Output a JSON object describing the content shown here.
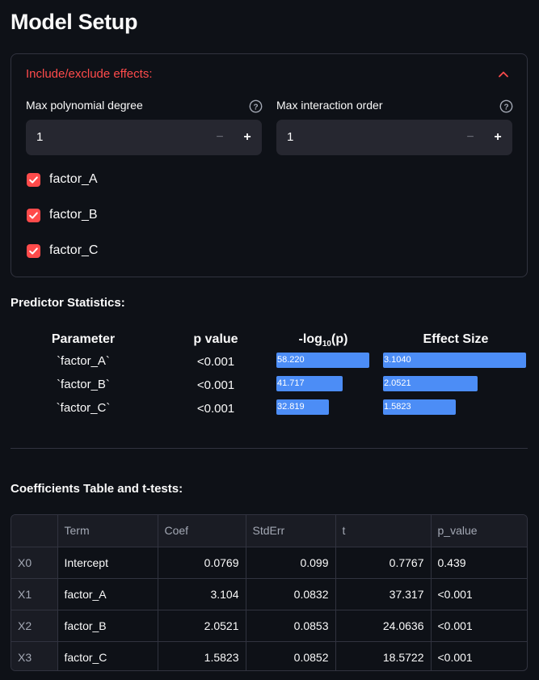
{
  "page": {
    "title": "Model Setup"
  },
  "expander": {
    "title": "Include/exclude effects:",
    "poly_degree": {
      "label": "Max polynomial degree",
      "value": "1",
      "minus": "−",
      "plus": "+"
    },
    "interaction_order": {
      "label": "Max interaction order",
      "value": "1",
      "minus": "−",
      "plus": "+"
    },
    "factors": [
      {
        "label": "factor_A",
        "checked": true
      },
      {
        "label": "factor_B",
        "checked": true
      },
      {
        "label": "factor_C",
        "checked": true
      }
    ]
  },
  "predictor_stats": {
    "title": "Predictor Statistics:",
    "headers": {
      "parameter": "Parameter",
      "p_value": "p value",
      "neglog_prefix": "-log",
      "neglog_sub": "10",
      "neglog_suffix": "(p)",
      "effect": "Effect Size"
    },
    "rows": [
      {
        "param": "`factor_A`",
        "p": "<0.001",
        "neglog": "58.220",
        "neglog_val": 58.22,
        "effect": "3.1040",
        "effect_val": 3.104
      },
      {
        "param": "`factor_B`",
        "p": "<0.001",
        "neglog": "41.717",
        "neglog_val": 41.717,
        "effect": "2.0521",
        "effect_val": 2.0521
      },
      {
        "param": "`factor_C`",
        "p": "<0.001",
        "neglog": "32.819",
        "neglog_val": 32.819,
        "effect": "1.5823",
        "effect_val": 1.5823
      }
    ],
    "bar_color": "#4c8df6"
  },
  "coef_table": {
    "title": "Coefficients Table and t-tests:",
    "columns": [
      "",
      "Term",
      "Coef",
      "StdErr",
      "t",
      "p_value"
    ],
    "rows": [
      [
        "X0",
        "Intercept",
        "0.0769",
        "0.099",
        "0.7767",
        "0.439"
      ],
      [
        "X1",
        "factor_A",
        "3.104",
        "0.0832",
        "37.317",
        "<0.001"
      ],
      [
        "X2",
        "factor_B",
        "2.0521",
        "0.0853",
        "24.0636",
        "<0.001"
      ],
      [
        "X3",
        "factor_C",
        "1.5823",
        "0.0852",
        "18.5722",
        "<0.001"
      ]
    ]
  },
  "colors": {
    "accent": "#ff4b4b",
    "background": "#0e1117",
    "input_bg": "#262730"
  }
}
